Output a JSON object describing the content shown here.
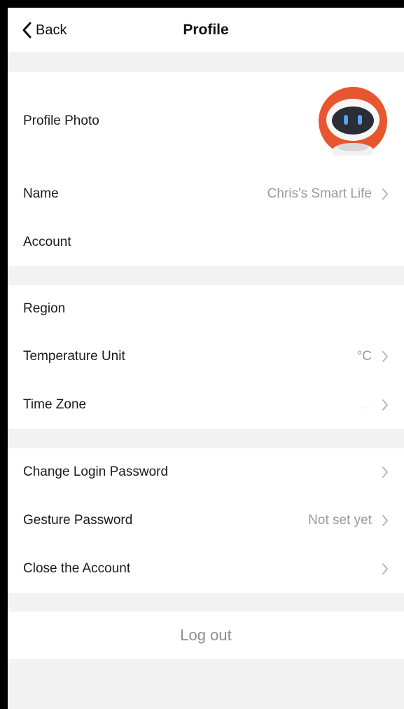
{
  "nav": {
    "back_label": "Back",
    "back_icon": "chevron-left-icon",
    "title": "Profile"
  },
  "profile": {
    "photo_label": "Profile Photo",
    "avatar_icon": "robot-avatar-icon",
    "name_label": "Name",
    "name_value": "Chris's Smart Life",
    "account_label": "Account"
  },
  "settings": {
    "region_label": "Region",
    "temperature_label": "Temperature Unit",
    "temperature_value": "°C",
    "timezone_label": "Time Zone",
    "timezone_value": "..."
  },
  "security": {
    "change_password_label": "Change Login Password",
    "gesture_label": "Gesture Password",
    "gesture_value": "Not set yet",
    "close_account_label": "Close the Account"
  },
  "logout": {
    "label": "Log out"
  },
  "colors": {
    "background": "#f2f2f2",
    "card": "#ffffff",
    "avatar_orange": "#e8562f",
    "value_gray": "#9a9a9a"
  }
}
